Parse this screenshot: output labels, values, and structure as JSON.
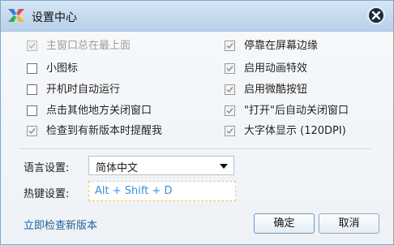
{
  "window": {
    "title": "设置中心"
  },
  "options": [
    {
      "label": "主窗口总在最上面",
      "checked": true,
      "disabled": true
    },
    {
      "label": "小图标",
      "checked": false,
      "disabled": false
    },
    {
      "label": "开机时自动运行",
      "checked": false,
      "disabled": false
    },
    {
      "label": "点击其他地方关闭窗口",
      "checked": false,
      "disabled": false
    },
    {
      "label": "检查到有新版本时提醒我",
      "checked": true,
      "disabled": false
    },
    {
      "label": "停靠在屏幕边缘",
      "checked": true,
      "disabled": false
    },
    {
      "label": "启用动画特效",
      "checked": true,
      "disabled": false
    },
    {
      "label": "启用微酷按钮",
      "checked": true,
      "disabled": false
    },
    {
      "label": "\"打开\"后自动关闭窗口",
      "checked": true,
      "disabled": false
    },
    {
      "label": "大字体显示 (120DPI)",
      "checked": true,
      "disabled": false
    }
  ],
  "language": {
    "label": "语言设置:",
    "value": "简体中文"
  },
  "hotkey": {
    "label": "热键设置:",
    "value": "Alt + Shift + D"
  },
  "footer": {
    "update_link": "立即检查新版本",
    "ok_label": "确定",
    "cancel_label": "取消"
  },
  "colors": {
    "link": "#1f5f9e",
    "hotkey_text": "#3b8fd6",
    "titlebar": "#c5d9ee"
  },
  "icons": {
    "logo": "app-logo-icon",
    "close": "close-icon",
    "dropdown": "chevron-down-icon",
    "check": "checkmark-icon"
  }
}
